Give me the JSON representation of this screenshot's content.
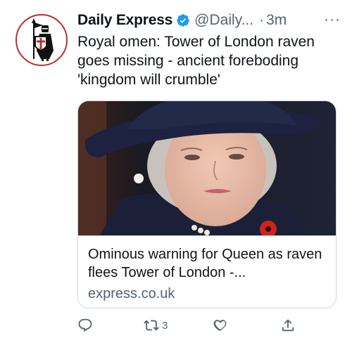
{
  "tweet": {
    "display_name": "Daily Express",
    "handle": "@Daily...",
    "separator": "·",
    "time": "3m",
    "more": "···",
    "text": "Royal omen: Tower of London raven goes missing - ancient foreboding 'kingdom will crumble'",
    "card": {
      "title": "Ominous warning for Queen as raven flees Tower of London -...",
      "domain": "express.co.uk"
    },
    "actions": {
      "reply_icon": "reply-icon",
      "retweet_icon": "retweet-icon",
      "retweet_count": "3",
      "like_icon": "heart-icon",
      "share_icon": "share-icon"
    }
  },
  "colors": {
    "text": "#0f1419",
    "secondary": "#536471",
    "verified": "#1d9bf0",
    "avatar_border": "#b9302c",
    "card_border": "#cfd9de"
  }
}
